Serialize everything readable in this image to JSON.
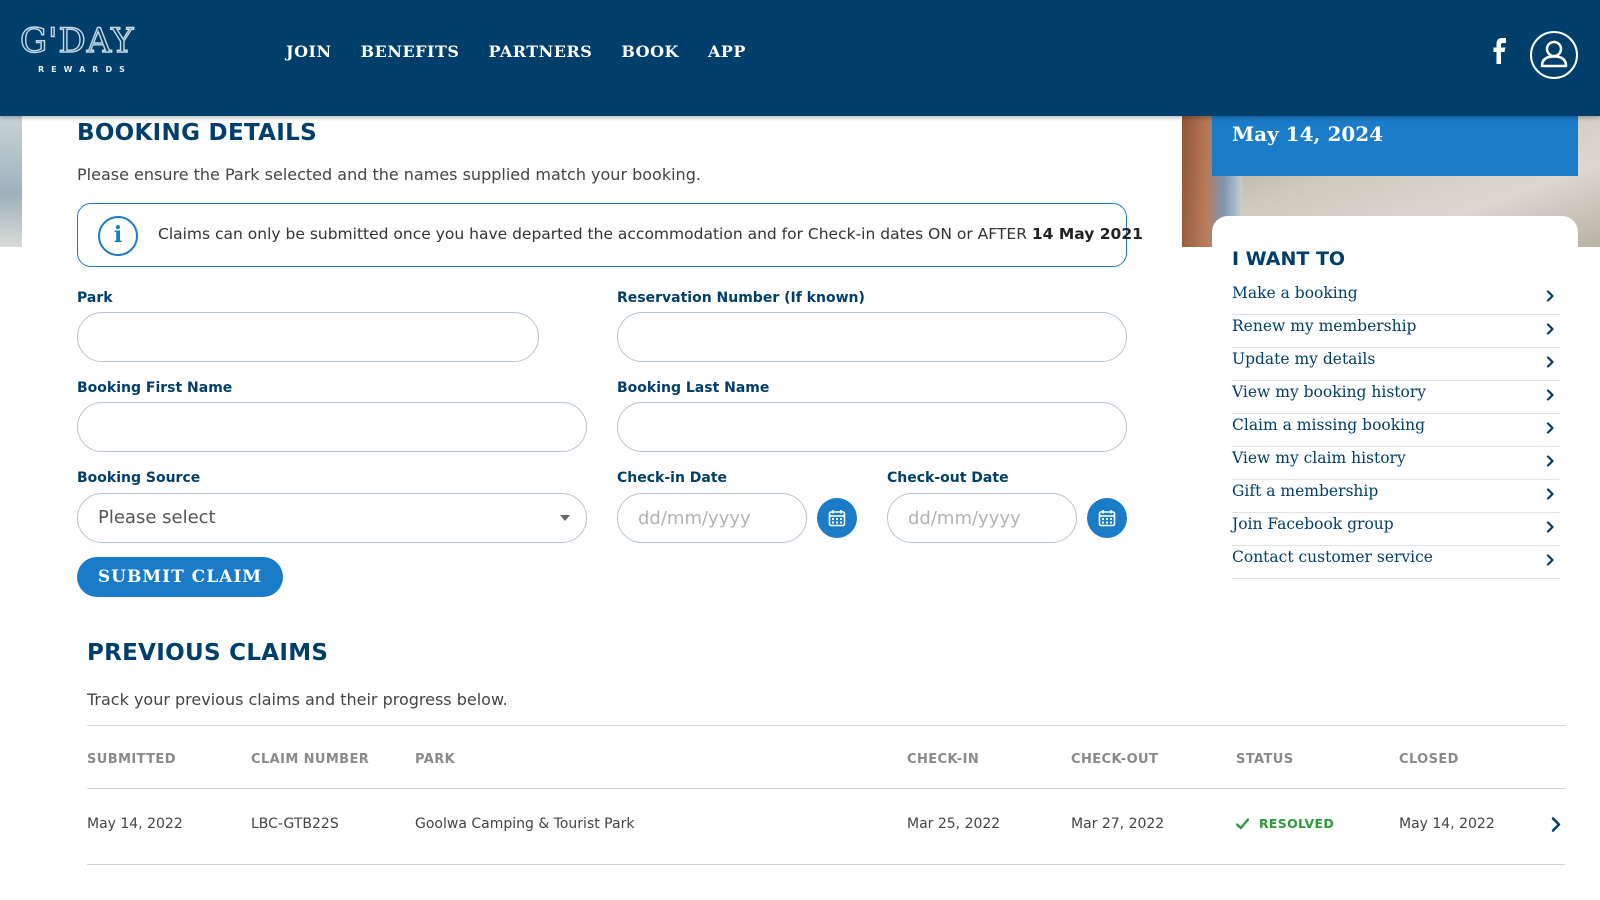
{
  "header": {
    "logo_main": "G'DAY",
    "logo_sub": "REWARDS",
    "nav": [
      "JOIN",
      "BENEFITS",
      "PARTNERS",
      "BOOK",
      "APP"
    ]
  },
  "banner": {
    "date": "May 14, 2024"
  },
  "booking": {
    "title": "BOOKING DETAILS",
    "helper": "Please ensure the Park selected and the names supplied match your booking.",
    "notice_text": "Claims can only be submitted once you have departed the accommodation and for Check-in dates ON or AFTER ",
    "notice_date": "14 May 2021",
    "park_label": "Park",
    "park_value": "",
    "reservation_label": "Reservation Number (If known)",
    "reservation_value": "",
    "first_name_label": "Booking First Name",
    "first_name_value": "",
    "last_name_label": "Booking Last Name",
    "last_name_value": "",
    "source_label": "Booking Source",
    "source_selected": "Please select",
    "checkin_label": "Check-in Date",
    "checkin_placeholder": "dd/mm/yyyy",
    "checkout_label": "Check-out Date",
    "checkout_placeholder": "dd/mm/yyyy",
    "submit_label": "SUBMIT CLAIM"
  },
  "previous_claims": {
    "title": "PREVIOUS CLAIMS",
    "helper": "Track your previous claims and their progress below.",
    "columns": [
      "SUBMITTED",
      "CLAIM NUMBER",
      "PARK",
      "CHECK-IN",
      "CHECK-OUT",
      "STATUS",
      "CLOSED"
    ],
    "rows": [
      {
        "submitted": "May 14, 2022",
        "claim_number": "LBC-GTB22S",
        "park": "Goolwa Camping & Tourist Park",
        "check_in": "Mar 25, 2022",
        "check_out": "Mar 27, 2022",
        "status": "RESOLVED",
        "closed": "May 14, 2022"
      }
    ]
  },
  "sidebar": {
    "title": "I WANT TO",
    "items": [
      "Make a booking",
      "Renew my membership",
      "Update my details",
      "View my booking history",
      "Claim a missing booking",
      "View my claim history",
      "Gift a membership",
      "Join Facebook group",
      "Contact customer service"
    ]
  },
  "colors": {
    "header_bg": "#003f6b",
    "accent": "#1a7bc8",
    "status_resolved": "#2e9a3c"
  }
}
